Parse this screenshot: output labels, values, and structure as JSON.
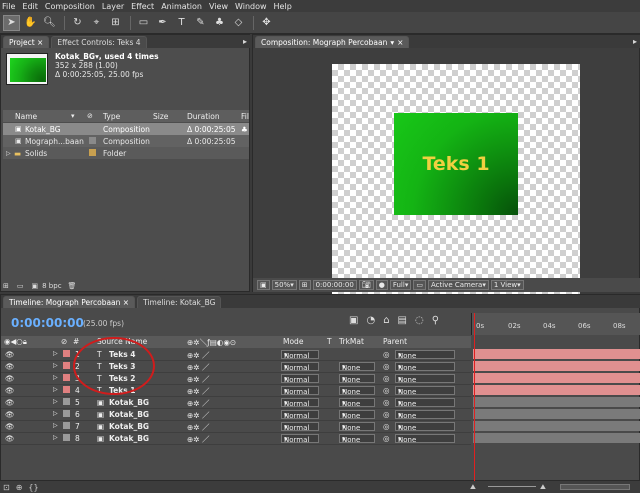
{
  "menu": [
    "File",
    "Edit",
    "Composition",
    "Layer",
    "Effect",
    "Animation",
    "View",
    "Window",
    "Help"
  ],
  "project": {
    "tabs": [
      "Project ×",
      "Effect Controls: Teks 4"
    ],
    "selected_name": "Kotak_BG▾, used 4 times",
    "selected_dims": "352 x 288 (1.00)",
    "selected_duration": "Δ 0:00:25:05, 25.00 fps",
    "columns": [
      "Name",
      "Type",
      "Size",
      "Duration",
      "Fil"
    ],
    "items": [
      {
        "name": "Kotak_BG",
        "type": "Composition",
        "duration": "Δ 0:00:25:05",
        "color": "#8a8a8a"
      },
      {
        "name": "Mograph...baan",
        "type": "Composition",
        "duration": "Δ 0:00:25:05",
        "color": "#8a8a8a"
      },
      {
        "name": "Solids",
        "type": "Folder",
        "duration": "",
        "color": "#c8a050"
      }
    ],
    "bpc": "8 bpc"
  },
  "composition": {
    "tab": "Composition: Mograph Percobaan",
    "text": "Teks 1",
    "zoom": "50%",
    "timecode": "0:00:00:00",
    "resolution": "Full",
    "camera": "Active Camera",
    "view": "1 View"
  },
  "timeline": {
    "tabs": [
      "Timeline: Mograph Percobaan ×",
      "Timeline: Kotak_BG"
    ],
    "timecode": "0:00:00:00",
    "fps": "(25.00 fps)",
    "headers": {
      "num": "#",
      "source": "Source Name",
      "mode": "Mode",
      "t": "T",
      "trkmat": "TrkMat",
      "parent": "Parent"
    },
    "ruler_ticks": [
      "0s",
      "02s",
      "04s",
      "06s",
      "08s"
    ],
    "layers": [
      {
        "num": "1",
        "name": "Teks 4",
        "kind": "text",
        "mode": "Normal",
        "trkmat": "",
        "parent": "None",
        "label": "#e08080"
      },
      {
        "num": "2",
        "name": "Teks 3",
        "kind": "text",
        "mode": "Normal",
        "trkmat": "None",
        "parent": "None",
        "label": "#e08080"
      },
      {
        "num": "3",
        "name": "Teks 2",
        "kind": "text",
        "mode": "Normal",
        "trkmat": "None",
        "parent": "None",
        "label": "#e08080"
      },
      {
        "num": "4",
        "name": "Teks 1",
        "kind": "text",
        "mode": "Normal",
        "trkmat": "None",
        "parent": "None",
        "label": "#e08080"
      },
      {
        "num": "5",
        "name": "Kotak_BG",
        "kind": "comp",
        "mode": "Normal",
        "trkmat": "None",
        "parent": "None",
        "label": "#9a9a9a"
      },
      {
        "num": "6",
        "name": "Kotak_BG",
        "kind": "comp",
        "mode": "Normal",
        "trkmat": "None",
        "parent": "None",
        "label": "#9a9a9a"
      },
      {
        "num": "7",
        "name": "Kotak_BG",
        "kind": "comp",
        "mode": "Normal",
        "trkmat": "None",
        "parent": "None",
        "label": "#9a9a9a"
      },
      {
        "num": "8",
        "name": "Kotak_BG",
        "kind": "comp",
        "mode": "Normal",
        "trkmat": "None",
        "parent": "None",
        "label": "#9a9a9a"
      }
    ]
  },
  "colors": {
    "text_bar": "#e09090",
    "comp_bar": "#7a7a7a",
    "timecode": "#6ab0ff",
    "playhead": "#e02020",
    "highlight_circle": "#d01c1c"
  }
}
